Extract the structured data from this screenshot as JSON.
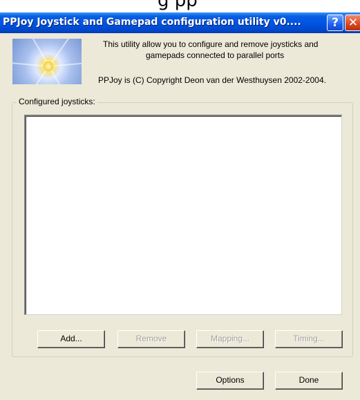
{
  "cropped_header_text": "g      pp",
  "window": {
    "title": "PPJoy Joystick and Gamepad configuration utility   v0....",
    "help_label": "?",
    "close_label": "✕"
  },
  "banner": {
    "line1": "This utility allow you to configure and remove joysticks and",
    "line2": "gamepads connected to parallel ports",
    "copyright": "PPJoy is (C) Copyright Deon van der Westhuysen 2002-2004."
  },
  "group": {
    "label": "Configured joysticks:",
    "items": []
  },
  "buttons": {
    "add": "Add...",
    "remove": "Remove",
    "mapping": "Mapping...",
    "timing": "Timing...",
    "options": "Options",
    "done": "Done"
  },
  "colors": {
    "titlebar": "#0054e3",
    "dialog_bg": "#ece9d8",
    "close_button": "#d9471f"
  },
  "icons": [
    "help-icon",
    "close-icon",
    "banner-image"
  ]
}
